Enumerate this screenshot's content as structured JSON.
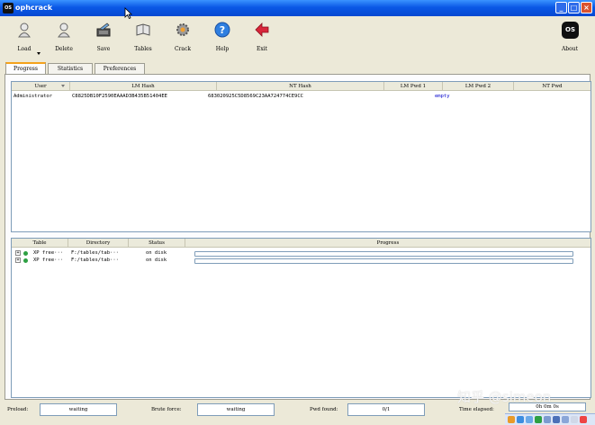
{
  "window": {
    "title": "ophcrack",
    "icon_text": "OS",
    "min": "_",
    "max": "□",
    "close": "×"
  },
  "toolbar": {
    "load": "Load",
    "delete": "Delete",
    "save": "Save",
    "tables": "Tables",
    "crack": "Crack",
    "help": "Help",
    "exit": "Exit",
    "about": "About",
    "about_logo": "OS"
  },
  "tabs": [
    "Progress",
    "Statistics",
    "Preferences"
  ],
  "users": {
    "columns": [
      "User",
      "LM Hash",
      "NT Hash",
      "LM Pwd 1",
      "LM Pwd 2",
      "NT Pwd"
    ],
    "rows": [
      {
        "user": "Administrator",
        "lm_hash": "C8825DB10F2590EAAAD3B435B51404EE",
        "nt_hash": "683020925C5D8569C23AA724774CE9CC",
        "lm_pwd1": "",
        "lm_pwd2": "empty",
        "nt_pwd": ""
      }
    ]
  },
  "tables_list": {
    "columns": [
      "Table",
      "Directory",
      "Status",
      "Progress"
    ],
    "rows": [
      {
        "expander": "+",
        "table": "XP free···",
        "directory": "F:/tables/tab···",
        "status": "on disk",
        "progress": 0
      },
      {
        "expander": "+",
        "table": "XP free···",
        "directory": "F:/tables/tab···",
        "status": "on disk",
        "progress": 0
      }
    ]
  },
  "statusbar": {
    "preload_label": "Preload:",
    "preload_value": "waiting",
    "brute_label": "Brute force:",
    "brute_value": "waiting",
    "pwd_label": "Pwd found:",
    "pwd_value": "0/1",
    "time_label": "Time elapsed:",
    "time_value": "0h 0m 0s"
  },
  "watermark": "知乎 @simeon",
  "colors": {
    "titlebar": "#0A58E6",
    "window_bg": "#ECE9D8",
    "empty_pwd": "#0000CC",
    "tab_active_top": "#F4A21C"
  }
}
